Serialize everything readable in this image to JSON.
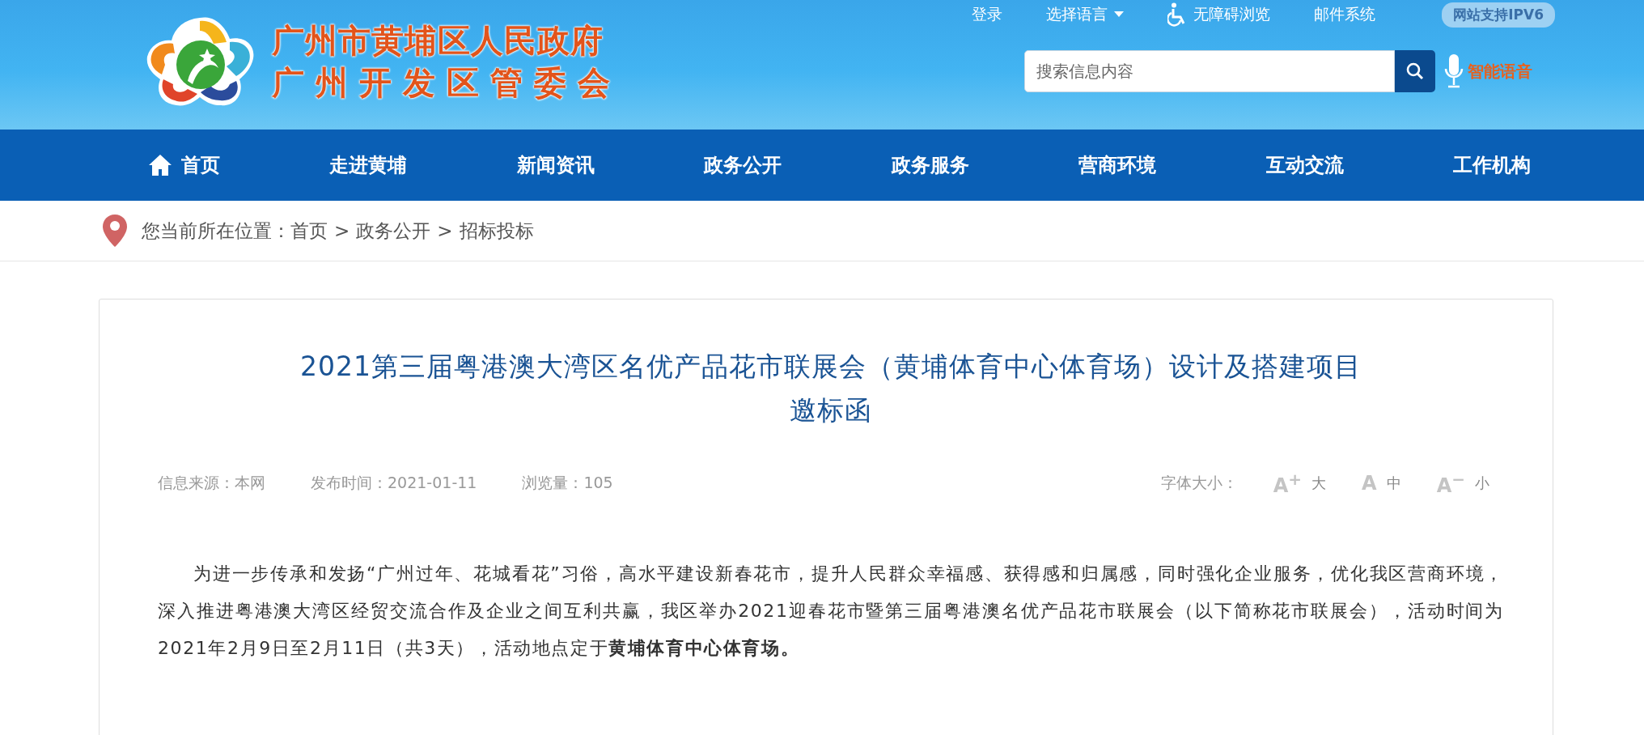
{
  "header": {
    "site_name_lines": [
      "广州市黄埔区人民政府",
      "广州开发区管委会"
    ],
    "top_links": [
      {
        "label": "登录",
        "kind": "plain"
      },
      {
        "label": "选择语言",
        "kind": "dropdown"
      },
      {
        "label": "无障碍浏览",
        "kind": "accessibility"
      },
      {
        "label": "邮件系统",
        "kind": "plain"
      }
    ],
    "ipv6_badge": "网站支持IPV6",
    "search": {
      "placeholder": "搜索信息内容"
    },
    "voice_label": "智能语音"
  },
  "nav": [
    {
      "label": "首页",
      "kind": "home"
    },
    {
      "label": "走进黄埔",
      "kind": "plain"
    },
    {
      "label": "新闻资讯",
      "kind": "plain"
    },
    {
      "label": "政务公开",
      "kind": "plain"
    },
    {
      "label": "政务服务",
      "kind": "plain"
    },
    {
      "label": "营商环境",
      "kind": "plain"
    },
    {
      "label": "互动交流",
      "kind": "plain"
    },
    {
      "label": "工作机构",
      "kind": "plain"
    }
  ],
  "breadcrumb": {
    "prefix": "您当前所在位置：",
    "items": [
      "首页",
      "政务公开",
      "招标投标"
    ],
    "separator": ">"
  },
  "article": {
    "title_lines": [
      "2021第三届粤港澳大湾区名优产品花市联展会（黄埔体育中心体育场）设计及搭建项目",
      "邀标函"
    ],
    "meta": [
      "信息来源：本网",
      "发布时间：2021-01-11",
      "浏览量：105"
    ],
    "font_size_label": "字体大小：",
    "font_sizes": [
      {
        "glyph": "A",
        "sign": "+",
        "label": "大"
      },
      {
        "glyph": "A",
        "label": "中"
      },
      {
        "glyph": "A",
        "sign": "−",
        "label": "小"
      }
    ],
    "paragraph": "为进一步传承和发扬“广州过年、花城看花”习俗，高水平建设新春花市，提升人民群众幸福感、获得感和归属感，同时强化企业服务，优化我区营商环境，深入推进粤港澳大湾区经贸交流合作及企业之间互利共赢，我区举办2021迎春花市暨第三届粤港澳名优产品花市联展会（以下简称花市联展会），活动时间为2021年2月9日至2月11日（共3天），活动地点定于**黄埔体育中心体育场。**"
  }
}
